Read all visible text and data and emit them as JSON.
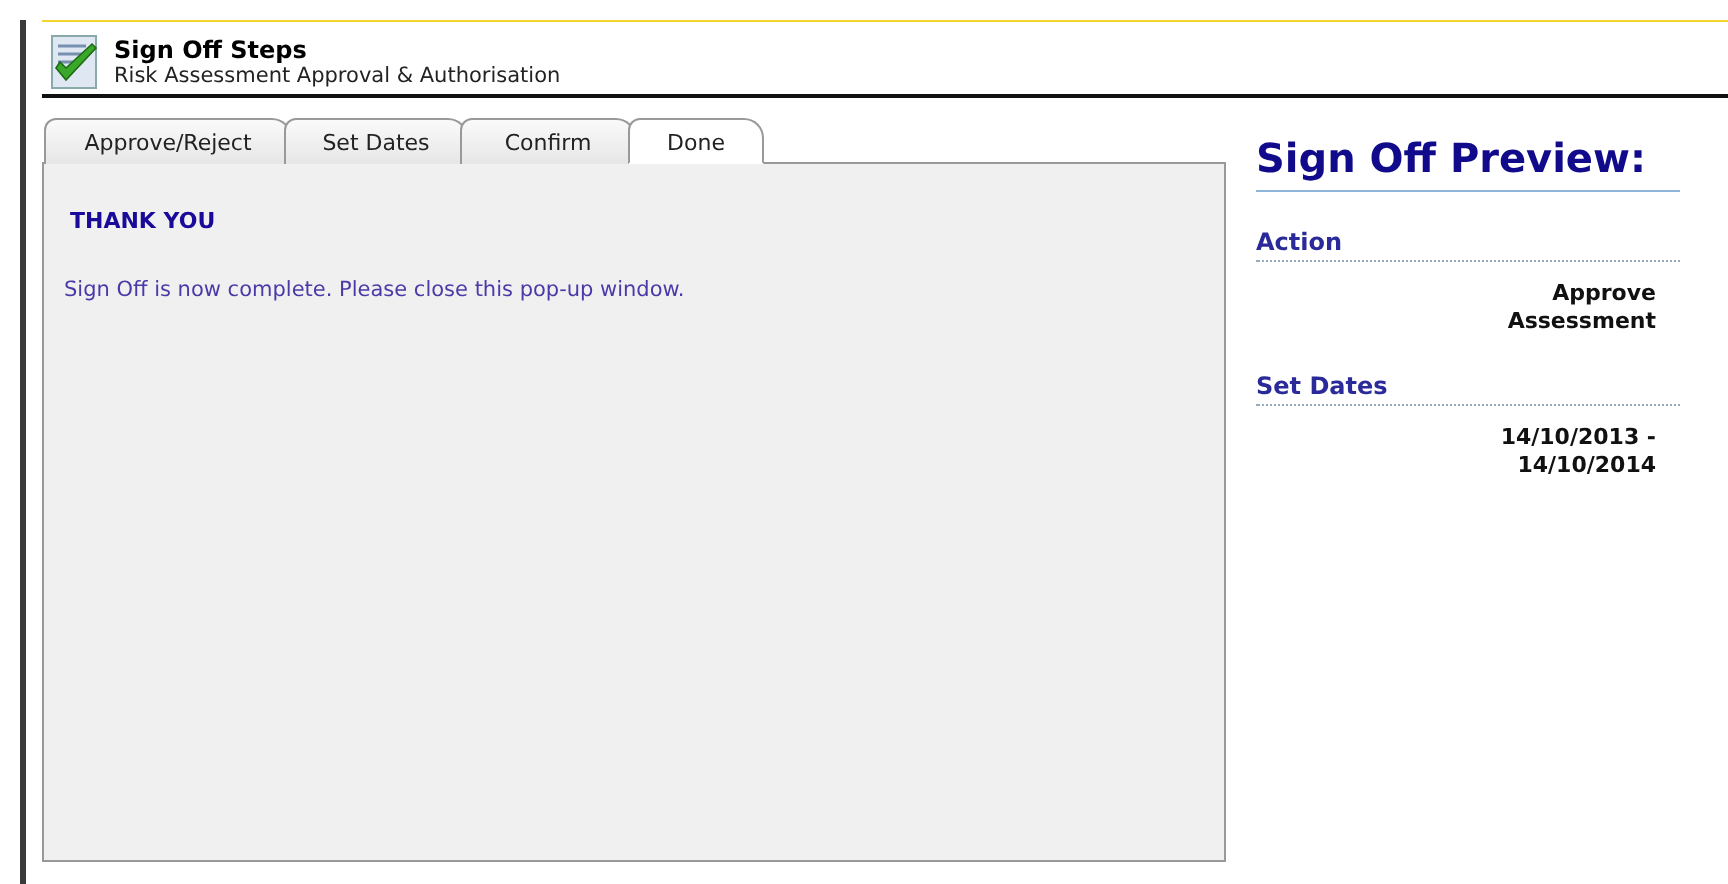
{
  "header": {
    "title": "Sign Off Steps",
    "subtitle": "Risk Assessment Approval & Authorisation"
  },
  "tabs": [
    {
      "label": "Approve/Reject",
      "selected": false
    },
    {
      "label": "Set Dates",
      "selected": false
    },
    {
      "label": "Confirm",
      "selected": false
    },
    {
      "label": "Done",
      "selected": true
    }
  ],
  "panel": {
    "heading": "THANK YOU",
    "message": "Sign Off is now complete. Please close this pop-up window."
  },
  "preview": {
    "title": "Sign Off Preview:",
    "sections": [
      {
        "label": "Action",
        "value": "Approve Assessment"
      },
      {
        "label": "Set Dates",
        "value": "14/10/2013 - 14/10/2014"
      }
    ]
  }
}
